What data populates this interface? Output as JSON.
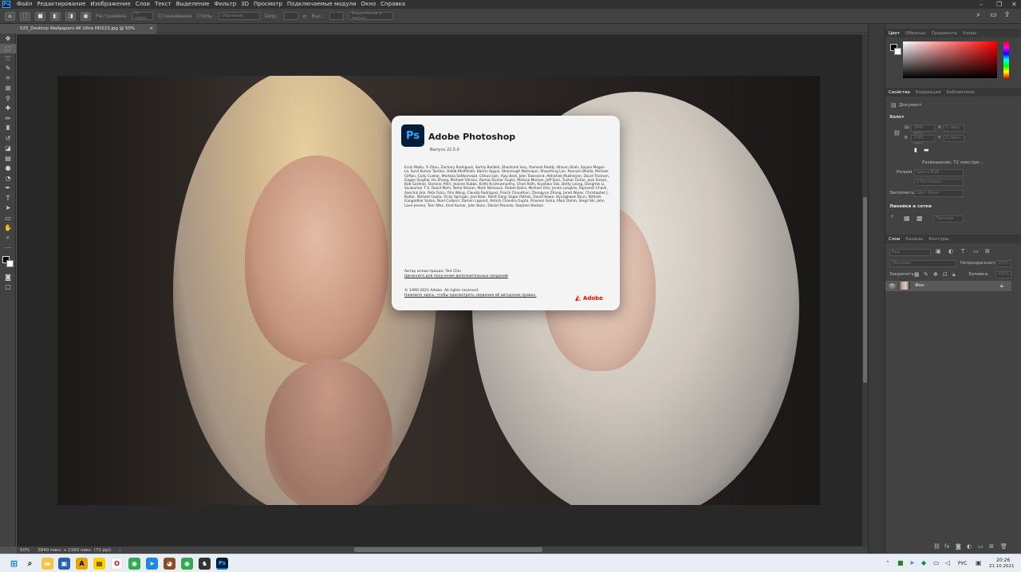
{
  "menu": {
    "items": [
      "Файл",
      "Редактирование",
      "Изображение",
      "Слои",
      "Текст",
      "Выделение",
      "Фильтр",
      "3D",
      "Просмотр",
      "Подключаемые модули",
      "Окно",
      "Справка"
    ]
  },
  "options": {
    "feather_label": "Растушевка:",
    "feather_value": "0 пикс.",
    "antialias_label": "Сглаживание",
    "style_label": "Стиль:",
    "style_value": "Обычный",
    "width_label": "Шир.:",
    "height_label": "Выс.:",
    "select_mask_label": "Выделение и маска..."
  },
  "document": {
    "tab_label": "025_Desktop Wallpapers 4K Ultra HD223.jpg @ 50% (RGB/8#)",
    "close_glyph": "×"
  },
  "status": {
    "zoom": "50%",
    "info": "3840 пикс. x 2160 пикс. (72 ppi)",
    "arrow": "›"
  },
  "color_panel": {
    "tabs": [
      "Цвет",
      "Образцы",
      "Градиенты",
      "Узоры"
    ]
  },
  "properties_panel": {
    "tabs": [
      "Свойства",
      "Коррекция",
      "Библиотеки"
    ],
    "doc_label": "Документ",
    "canvas_section": "Холст",
    "w_label": "Ш",
    "h_label": "В",
    "x_label": "X",
    "y_label": "Y",
    "w_value": "3840 пикс.",
    "h_value": "2160 пикс.",
    "x_value": "0 пикс.",
    "y_value": "0 пикс.",
    "resolution": "Разрешение: 72 пикс/дю...",
    "mode_label": "Режим",
    "mode_value": "Цвета RGB",
    "bits_value": "8 бит/канал",
    "fill_label": "Заполнить",
    "fill_value": "Цвет фона",
    "rulers_section": "Линейки и сетки",
    "units_value": "Пиксели"
  },
  "layers_panel": {
    "tabs": [
      "Слои",
      "Каналы",
      "Контуры"
    ],
    "search_placeholder": "Вид",
    "blend_mode": "Обычные",
    "opacity_label": "Непрозрачность:",
    "opacity_value": "100%",
    "lock_label": "Закрепить:",
    "fill_label": "Заливка:",
    "fill_value": "100%",
    "layer_name": "Фон"
  },
  "about": {
    "logo_text": "Ps",
    "title": "Adobe Photoshop",
    "version": "Выпуск 22.5.0",
    "credits": "Ersin Mutlu, Yi Zhou, Zachary Rodriguez, Serhiy Bullakh, Shashank Ivey, Ramesh Reddy, Bhavin Shah, Sayani Megan Le, Sunil Kumar Tandon, Habib Khalfallah, Barkin Aygun, Shanmugh Natarajan, Shaoshing Lee, Poonam Bhalla, Michael Clifton, Cody Cuellar, Morteza Safdarnejad, Chhavi Jain, Ajay Bedi, John Townsend, Abhishek Mukherjee, David Tristram, Gagan Singhal, He Zhang, Michael Vitrano, Raman Kumar Gupta, Melissa Monroe, Jeff Sass, Tushar Turkar, Jack Sisson, Bob Gardner, Dominic Petri, Jeanne Rubbo, Kirthi Krishnamurthy, Chad Rolfs, Kiyotaka Taki, Betty Leong, Dongmei Li, Sivakumar T A, David Mohr, Neha Sharan, Mark Nichoson, Ridam Batra, Michael Orts, Jenée Langlois, Rajneesh Chavli, Aanchal Jain, Pete Falco, Yilin Wang, Claudia Rodriguez, Prachi Chaudhari, Zhengyun Zhang, Jared Wyles, Christopher J. Butler, Nishant Gupta, Vicky Springer, Joel Baer, Rohit Garg, Sagar Pathak, David Howe, Hyunghwan Byun, Nithesh Gangadhar Salian, Noel Carboni, Damon Lapoint, Ashish Chandra Gupta, Praveen Gelra, Mark Dahm, Vergil Shi, John Love-Jensen, Tom Attix, Amit Kumar, John Beier, Daniel Presedo, Stephen Nielson",
    "artwork_by": "Автор иллюстрации: Ted Chin",
    "artwork_link": "Щелкните для получения дополнительных сведений",
    "copyright": "© 1990-2021 Adobe. All rights reserved.",
    "legal_link": "Нажмите здесь, чтобы просмотреть сведения об авторских правах.",
    "brand": "Adobe"
  },
  "taskbar": {
    "lang": "РУС",
    "time": "20:26",
    "date": "21.10.2021"
  }
}
